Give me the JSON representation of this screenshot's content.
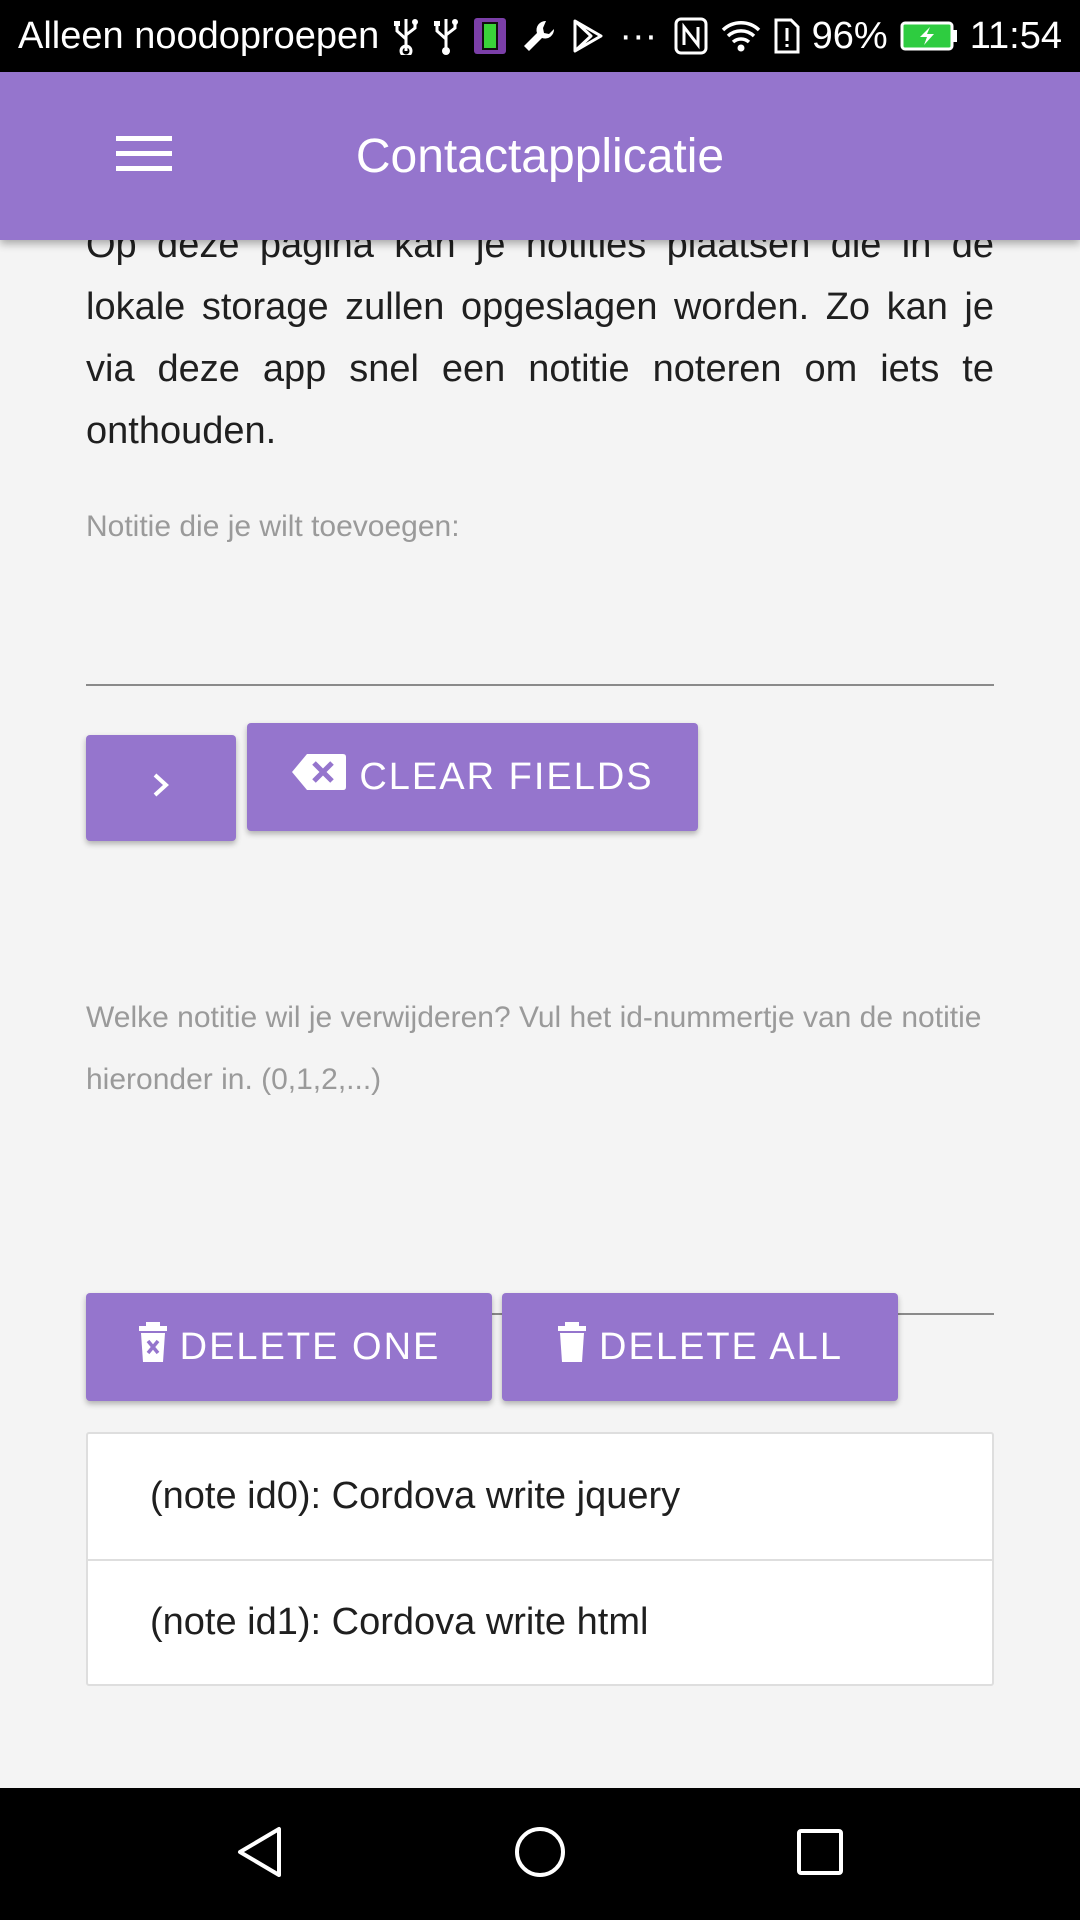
{
  "status_bar": {
    "carrier_text": "Alleen noodoproepen",
    "battery_percent": "96%",
    "time": "11:54",
    "overflow": "···",
    "icons": [
      "usb-icon",
      "usb-icon",
      "battery-app-icon",
      "wrench-icon",
      "play-store-icon",
      "nfc-icon",
      "wifi-icon",
      "sim-alert-icon",
      "battery-charging-icon"
    ]
  },
  "app_bar": {
    "title": "Contactapplicatie",
    "menu_icon": "hamburger-menu-icon"
  },
  "intro": {
    "text": "Op deze pagina kan je notities plaatsen die in de lokale storage zullen opgeslagen worden. Zo kan je via deze app snel een notitie noteren om iets te onthouden."
  },
  "add_note": {
    "label": "Notitie die je wilt toevoegen:",
    "value": "",
    "submit_icon": "chevron-right-icon",
    "clear_label": "CLEAR FIELDS",
    "clear_icon": "backspace-icon"
  },
  "delete_note": {
    "label": "Welke notitie wil je verwijderen? Vul het id-nummertje van de notitie hieronder in. (0,1,2,...)",
    "value": "",
    "delete_one_label": "DELETE ONE",
    "delete_one_icon": "trash-x-icon",
    "delete_all_label": "DELETE ALL",
    "delete_all_icon": "trash-icon"
  },
  "notes": [
    {
      "text": "(note id0): Cordova write jquery"
    },
    {
      "text": "(note id1): Cordova write html"
    }
  ],
  "nav_bar": {
    "icons": [
      "back-triangle-icon",
      "home-circle-icon",
      "recents-square-icon"
    ]
  },
  "colors": {
    "accent": "#9575cd",
    "background": "#f4f4f4",
    "status_bar": "#000000",
    "battery": "#2ecc40"
  }
}
